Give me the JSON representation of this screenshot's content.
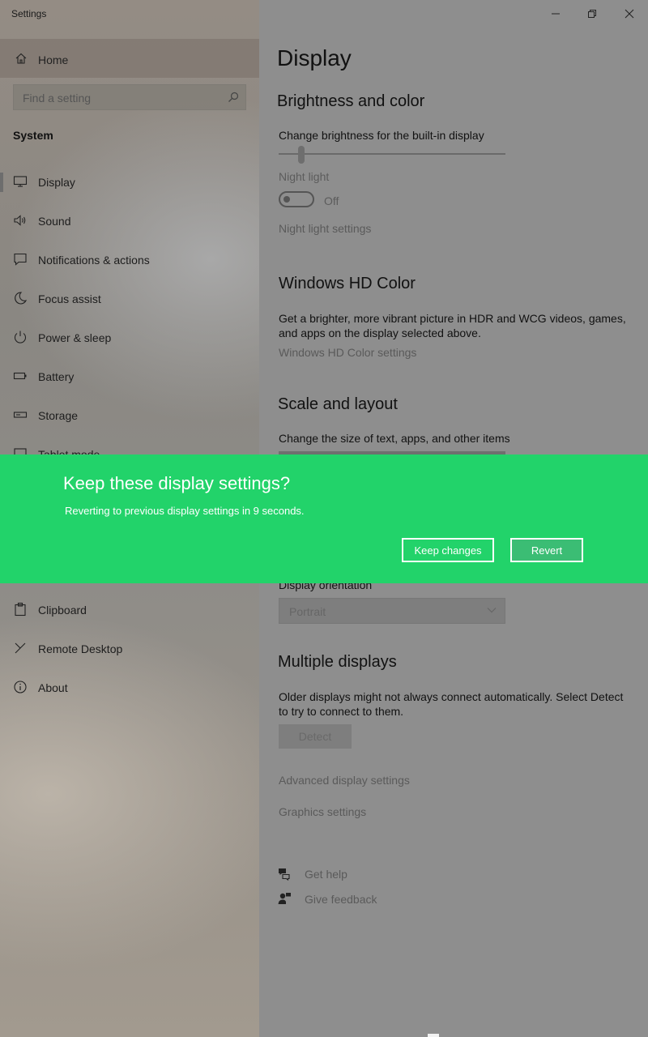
{
  "window": {
    "title": "Settings",
    "controls": {
      "minimize": "—",
      "restore": "❐",
      "close": "✕"
    }
  },
  "sidebar": {
    "home_label": "Home",
    "search": {
      "placeholder": "Find a setting"
    },
    "section_title": "System",
    "items": [
      {
        "label": "Display",
        "icon": "monitor-icon",
        "selected": true
      },
      {
        "label": "Sound",
        "icon": "speaker-icon"
      },
      {
        "label": "Notifications & actions",
        "icon": "notification-icon"
      },
      {
        "label": "Focus assist",
        "icon": "moon-icon"
      },
      {
        "label": "Power & sleep",
        "icon": "power-icon"
      },
      {
        "label": "Battery",
        "icon": "battery-icon"
      },
      {
        "label": "Storage",
        "icon": "storage-icon"
      },
      {
        "label": "Tablet mode",
        "icon": "tablet-icon"
      },
      {
        "label": "Clipboard",
        "icon": "clipboard-icon"
      },
      {
        "label": "Remote Desktop",
        "icon": "remote-desktop-icon"
      },
      {
        "label": "About",
        "icon": "info-icon"
      }
    ]
  },
  "main": {
    "title": "Display",
    "brightness": {
      "heading": "Brightness and color",
      "slider_label": "Change brightness for the built-in display",
      "night_light_label": "Night light",
      "night_light_state": "Off",
      "night_light_settings": "Night light settings",
      "level_fraction": 0.1
    },
    "hd_color": {
      "heading": "Windows HD Color",
      "description": "Get a brighter, more vibrant picture in HDR and WCG videos, games, and apps on the display selected above.",
      "settings_link": "Windows HD Color settings"
    },
    "scale": {
      "heading": "Scale and layout",
      "size_label": "Change the size of text, apps, and other items",
      "orientation_label": "Display orientation",
      "orientation_value": "Portrait"
    },
    "multiple": {
      "heading": "Multiple displays",
      "description": "Older displays might not always connect automatically. Select Detect to try to connect to them.",
      "detect_button": "Detect",
      "advanced_link": "Advanced display settings",
      "graphics_link": "Graphics settings"
    },
    "help": {
      "get_help": "Get help",
      "give_feedback": "Give feedback"
    }
  },
  "dialog": {
    "title": "Keep these display settings?",
    "message": "Reverting to previous display settings in  9 seconds.",
    "keep_button": "Keep changes",
    "revert_button": "Revert",
    "color": "#22d36a"
  }
}
